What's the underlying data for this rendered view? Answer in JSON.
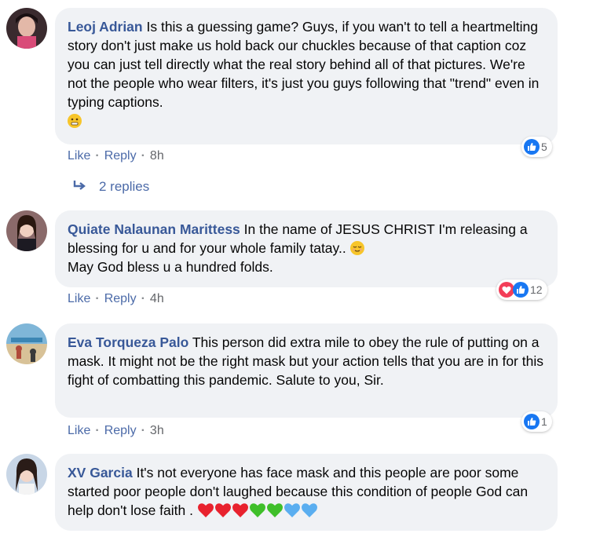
{
  "comments": [
    {
      "author": "Leoj Adrian",
      "text": "Is this a guessing game? Guys, if you wan't to tell a heartmelting story don't just make us hold back our chuckles because of that caption coz you can just tell directly what the real story behind all of that pictures. We're not the people who wear filters, it's just you guys following that \"trend\" even in typing captions.",
      "like_label": "Like",
      "reply_label": "Reply",
      "time": "8h",
      "reaction_count": "5",
      "replies_label": "2 replies"
    },
    {
      "author": "Quiate Nalaunan Marittess",
      "text": "In the name of JESUS CHRIST I'm releasing a blessing for u and for your whole family tatay..",
      "text2": "May God bless u a hundred folds.",
      "like_label": "Like",
      "reply_label": "Reply",
      "time": "4h",
      "reaction_count": "12"
    },
    {
      "author": "Eva Torqueza Palo",
      "text": "This person did extra mile to obey the rule of putting on a mask. It might not be the right mask but your action tells that you are in for this fight of combatting this pandemic. Salute to you, Sir.",
      "like_label": "Like",
      "reply_label": "Reply",
      "time": "3h",
      "reaction_count": "1"
    },
    {
      "author": "XV Garcia",
      "text": "It's not everyone has face mask and this people are poor some started poor people don't laughed because this condition of people God can help don't lose faith ."
    }
  ],
  "colors": {
    "author": "#385898",
    "action_link": "#4b6aa8",
    "bubble_bg": "#f0f2f5",
    "like_blue": "#1877f2",
    "love_red": "#f33e58",
    "heart_red": "#e8222e",
    "heart_green": "#3fbf2a",
    "heart_blue": "#5aaef0"
  }
}
